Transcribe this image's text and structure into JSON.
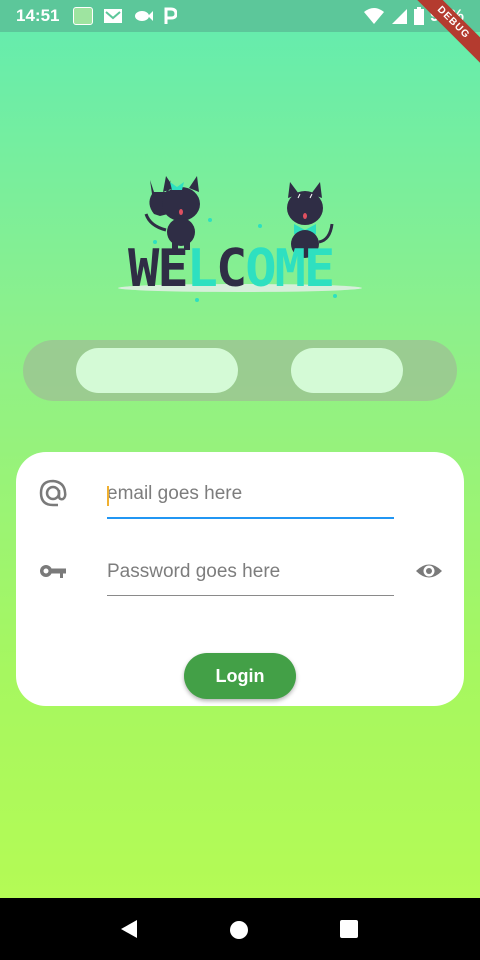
{
  "status_bar": {
    "time": "14:51",
    "battery": "99%",
    "debug_banner": "DEBUG"
  },
  "welcome": {
    "text": "WELCOME",
    "letters": [
      "W",
      "E",
      "L",
      "C",
      "O",
      "M",
      "E"
    ]
  },
  "toggle": {
    "option_1": "",
    "option_2": ""
  },
  "form": {
    "email_placeholder": "email goes here",
    "password_placeholder": "Password goes here",
    "login_label": "Login",
    "email_icon": "at-icon",
    "password_icon": "key-icon",
    "visibility_icon": "eye-icon"
  },
  "colors": {
    "accent_blue": "#2196f3",
    "login_green": "#43a047",
    "toggle_option": "#d4fad6"
  },
  "nav_bar": {
    "icons": [
      "back-icon",
      "home-icon",
      "recents-icon"
    ]
  }
}
